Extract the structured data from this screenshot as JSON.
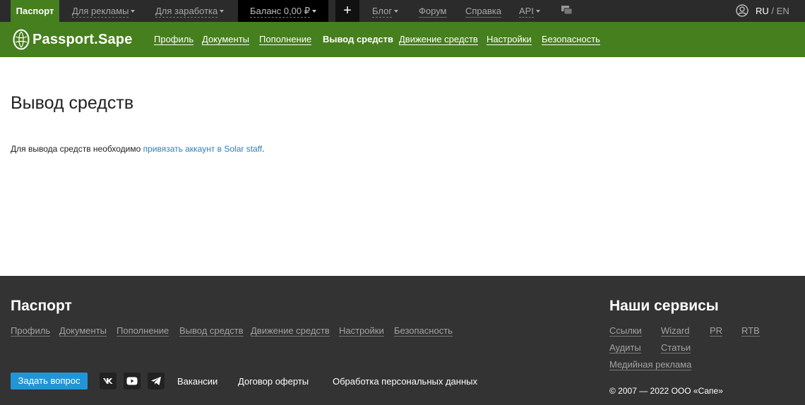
{
  "topbar": {
    "passport": "Паспорт",
    "for_ads": "Для рекламы",
    "for_earning": "Для заработка",
    "balance": "Баланс 0,00 ₽",
    "plus": "+",
    "blog": "Блог",
    "forum": "Форум",
    "help": "Справка",
    "api": "API",
    "chat_icon": "chat-icon",
    "user_icon": "user-circle-icon",
    "lang_ru": "RU",
    "lang_sep": "/",
    "lang_en": "EN"
  },
  "header": {
    "logo_text": "Passport.Sape",
    "nav": [
      {
        "label": "Профиль"
      },
      {
        "label": "Документы"
      },
      {
        "label": "Пополнение"
      },
      {
        "label": "Вывод средств"
      },
      {
        "label": "Движение средств"
      },
      {
        "label": "Настройки"
      },
      {
        "label": "Безопасность"
      }
    ]
  },
  "main": {
    "title": "Вывод средств",
    "notice_text": "Для вывода средств необходимо ",
    "notice_link": "привязать аккаунт в Solar staff",
    "notice_end": "."
  },
  "footer": {
    "passport_heading": "Паспорт",
    "passport_links": [
      {
        "label": "Профиль"
      },
      {
        "label": "Документы"
      },
      {
        "label": "Пополнение"
      },
      {
        "label": "Вывод средств"
      },
      {
        "label": "Движение средств"
      },
      {
        "label": "Настройки"
      },
      {
        "label": "Безопасность"
      }
    ],
    "services_heading": "Наши сервисы",
    "services": [
      {
        "label": "Ссылки"
      },
      {
        "label": "Wizard"
      },
      {
        "label": "PR"
      },
      {
        "label": "RTB"
      },
      {
        "label": "Аудиты"
      },
      {
        "label": "Статьи"
      },
      {
        "label": "Медийная реклама"
      }
    ],
    "ask_button": "Задать вопрос",
    "social": [
      "vk-icon",
      "youtube-icon",
      "telegram-icon"
    ],
    "links": [
      {
        "label": "Вакансии"
      },
      {
        "label": "Договор оферты"
      },
      {
        "label": "Обработка персональных данных"
      }
    ],
    "copyright": "© 2007 — 2022 ООО «Сапе»"
  },
  "colors": {
    "green": "#467f1d",
    "topbar": "#2b2b2b",
    "footer": "#333333",
    "link_blue": "#2d7fb8",
    "button_blue": "#2196d6"
  }
}
